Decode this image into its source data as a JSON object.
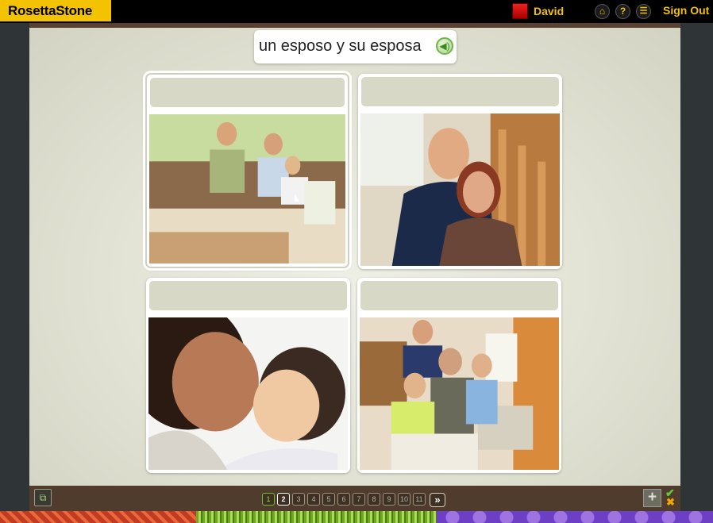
{
  "app": {
    "logo_text": "RosettaStone",
    "user_name": "David",
    "sign_out_label": "Sign Out",
    "icons": [
      "home-icon",
      "help-icon",
      "menu-icon"
    ]
  },
  "prompt": {
    "text": "un esposo y su esposa",
    "speaker_icon": "speaker-icon"
  },
  "cards": [
    {
      "caption": "",
      "image": "family of three on a couch",
      "selected": true
    },
    {
      "caption": "",
      "image": "husband and wife sitting together",
      "selected": false
    },
    {
      "caption": "",
      "image": "mother and baby",
      "selected": false
    },
    {
      "caption": "",
      "image": "grandfather with three children",
      "selected": false
    }
  ],
  "pagination": {
    "pages": [
      "1",
      "2",
      "3",
      "4",
      "5",
      "6",
      "7",
      "8",
      "9",
      "10",
      "11"
    ],
    "completed": [
      "1"
    ],
    "current": "2",
    "next_label": "»"
  },
  "bottom": {
    "review_icon": "review-icon",
    "add_icon": "plus-icon",
    "check_icon": "check-icon",
    "x_icon": "x-icon"
  },
  "colors": {
    "accent": "#f3c300",
    "frame_brown": "#4f3c2c",
    "panel": "#e6e6d9",
    "caption_box": "#d8d8c7",
    "done_green": "#6fbf2a"
  }
}
